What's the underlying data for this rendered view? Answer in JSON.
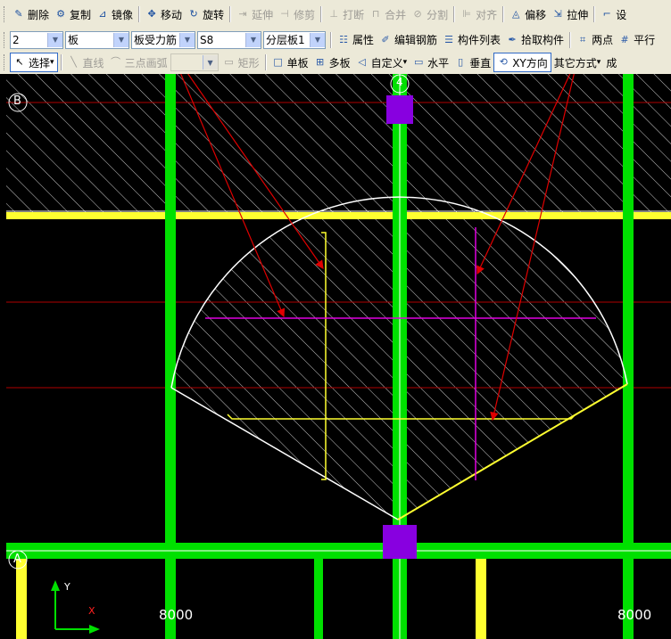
{
  "toolbar1": {
    "items": [
      {
        "label": "删除",
        "icon": "delete-icon",
        "glyph": "✎",
        "enabled": true
      },
      {
        "label": "复制",
        "icon": "copy-icon",
        "glyph": "⚙",
        "enabled": true
      },
      {
        "label": "镜像",
        "icon": "mirror-icon",
        "glyph": "⊿",
        "enabled": true
      },
      {
        "label": "移动",
        "icon": "move-icon",
        "glyph": "✥",
        "enabled": true
      },
      {
        "label": "旋转",
        "icon": "rotate-icon",
        "glyph": "↻",
        "enabled": true
      },
      {
        "label": "延伸",
        "icon": "extend-icon",
        "glyph": "⇥",
        "enabled": false
      },
      {
        "label": "修剪",
        "icon": "trim-icon",
        "glyph": "⊣",
        "enabled": false
      },
      {
        "label": "打断",
        "icon": "break-icon",
        "glyph": "⊥",
        "enabled": false
      },
      {
        "label": "合并",
        "icon": "merge-icon",
        "glyph": "⊓",
        "enabled": false
      },
      {
        "label": "分割",
        "icon": "split-icon",
        "glyph": "⊘",
        "enabled": false
      },
      {
        "label": "对齐",
        "icon": "align-icon",
        "glyph": "⊫",
        "enabled": false
      },
      {
        "label": "偏移",
        "icon": "offset-icon",
        "glyph": "◬",
        "enabled": true
      },
      {
        "label": "拉伸",
        "icon": "stretch-icon",
        "glyph": "⇲",
        "enabled": true
      },
      {
        "label": "设",
        "icon": "settings-icon",
        "glyph": "⌐",
        "enabled": true
      }
    ]
  },
  "toolbar2": {
    "combos": [
      {
        "value": "2"
      },
      {
        "value": "板"
      },
      {
        "value": "板受力筋"
      },
      {
        "value": "S8"
      },
      {
        "value": "分层板1"
      }
    ],
    "buttons": [
      {
        "label": "属性",
        "icon": "properties-icon",
        "glyph": "☷"
      },
      {
        "label": "编辑钢筋",
        "icon": "edit-rebar-icon",
        "glyph": "✐"
      },
      {
        "label": "构件列表",
        "icon": "component-list-icon",
        "glyph": "☰"
      },
      {
        "label": "拾取构件",
        "icon": "pick-component-icon",
        "glyph": "✒"
      },
      {
        "label": "两点",
        "icon": "two-points-icon",
        "glyph": "⌗"
      },
      {
        "label": "平行",
        "icon": "parallel-icon",
        "glyph": "#"
      }
    ]
  },
  "toolbar3": {
    "select_label": "选择",
    "disabled": [
      {
        "label": "直线",
        "icon": "line-icon",
        "glyph": "╲"
      },
      {
        "label": "三点画弧",
        "icon": "arc-icon",
        "glyph": "⌒"
      }
    ],
    "rect_label": "矩形",
    "buttons": [
      {
        "label": "单板",
        "icon": "single-slab-icon",
        "glyph": "□"
      },
      {
        "label": "多板",
        "icon": "multi-slab-icon",
        "glyph": "⊞"
      },
      {
        "label": "自定义",
        "icon": "custom-icon",
        "glyph": "◁"
      },
      {
        "label": "水平",
        "icon": "horizontal-icon",
        "glyph": "▭"
      },
      {
        "label": "垂直",
        "icon": "vertical-icon",
        "glyph": "▯"
      }
    ],
    "xy_label": "XY方向",
    "other_label": "其它方式",
    "trailing": "成"
  },
  "canvas": {
    "axis_top_left": "B",
    "axis_top_center": "4",
    "axis_bottom_left": "A",
    "dim_left": "8000",
    "dim_right": "8000",
    "ucs_y": "Y",
    "ucs_x": "X",
    "colors": {
      "grid_green": "#00e000",
      "beam_yellow": "#ffff30",
      "column_purple": "#8800e0",
      "magenta": "#e000e0",
      "annotation_red": "#e00000"
    }
  }
}
